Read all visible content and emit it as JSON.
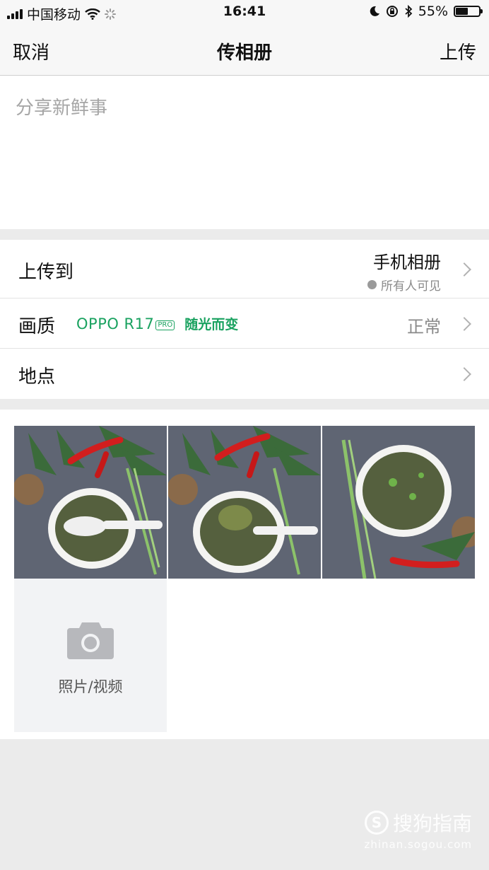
{
  "status_bar": {
    "carrier": "中国移动",
    "time": "16:41",
    "battery_percent": "55%",
    "battery_level": 0.55
  },
  "nav": {
    "cancel_label": "取消",
    "title": "传相册",
    "upload_label": "上传"
  },
  "compose": {
    "placeholder": "分享新鲜事"
  },
  "settings": {
    "upload_to": {
      "label": "上传到",
      "value": "手机相册",
      "visibility": "所有人可见"
    },
    "quality": {
      "label": "画质",
      "value": "正常",
      "ad_brand": "OPPO R17",
      "ad_badge": "PRO",
      "ad_slogan": "随光而变"
    },
    "location": {
      "label": "地点"
    }
  },
  "photos": {
    "add_label": "照片/视频"
  },
  "watermark": {
    "logo_letter": "S",
    "text": "搜狗指南",
    "url": "zhinan.sogou.com"
  },
  "colors": {
    "accent_green": "#1aa260",
    "background": "#ebebeb"
  }
}
